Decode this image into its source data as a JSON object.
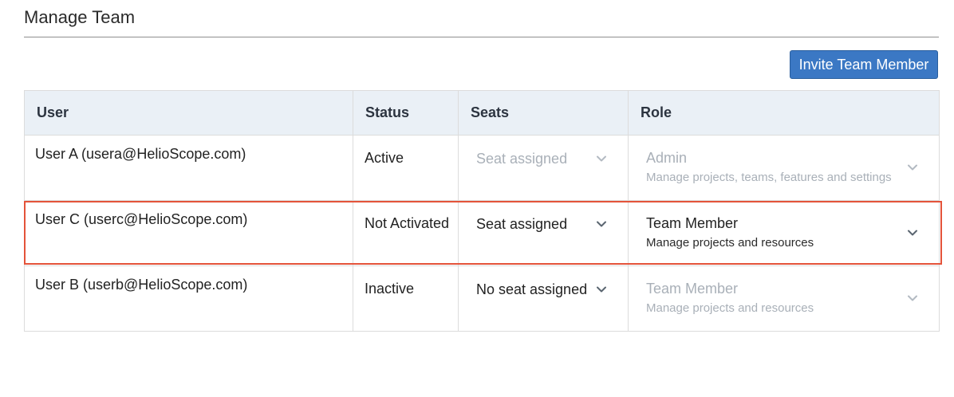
{
  "page": {
    "title": "Manage Team",
    "invite_button_label": "Invite Team Member"
  },
  "table": {
    "headers": [
      "User",
      "Status",
      "Seats",
      "Role"
    ],
    "rows": [
      {
        "user": "User A (usera@HelioScope.com)",
        "status": "Active",
        "seat": "Seat assigned",
        "seat_disabled": true,
        "role": "Admin",
        "role_description": "Manage projects, teams, features and settings",
        "role_disabled": true
      },
      {
        "user": "User C (userc@HelioScope.com)",
        "status": "Not Activated",
        "seat": "Seat assigned",
        "seat_disabled": false,
        "role": "Team Member",
        "role_description": "Manage projects and resources",
        "role_disabled": false,
        "highlighted": true
      },
      {
        "user": "User B (userb@HelioScope.com)",
        "status": "Inactive",
        "seat": "No seat assigned",
        "seat_disabled": false,
        "role": "Team Member",
        "role_description": "Manage projects and resources",
        "role_disabled": true
      }
    ]
  },
  "icons": {
    "dropdown": "chevron-down-icon"
  },
  "colors": {
    "primary_button": "#3b78c4",
    "header_background": "#eaf0f6",
    "highlight_border": "#e4533a",
    "disabled_text": "#a9b0b8"
  }
}
